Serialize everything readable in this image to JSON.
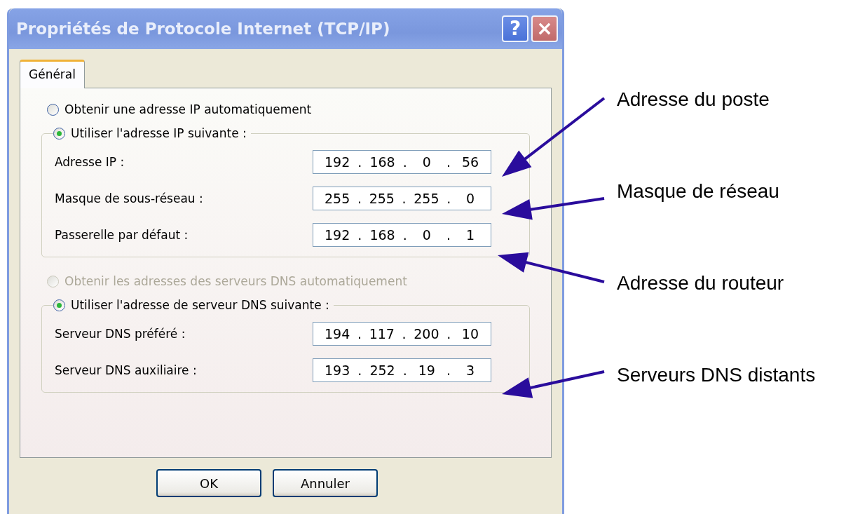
{
  "window": {
    "title": "Propriétés de Protocole Internet (TCP/IP)",
    "help": "?",
    "close": "×"
  },
  "tabs": [
    {
      "label": "Général",
      "selected": true
    }
  ],
  "ip_auto": {
    "label": "Obtenir une adresse IP automatiquement",
    "selected": false,
    "disabled": false
  },
  "ip_group": {
    "radio": {
      "label": "Utiliser l'adresse IP suivante :",
      "selected": true,
      "disabled": false
    },
    "fields": [
      {
        "label": "Adresse IP :",
        "octets": [
          "192",
          "168",
          "0",
          "56"
        ]
      },
      {
        "label": "Masque de sous-réseau :",
        "octets": [
          "255",
          "255",
          "255",
          "0"
        ]
      },
      {
        "label": "Passerelle par défaut :",
        "octets": [
          "192",
          "168",
          "0",
          "1"
        ]
      }
    ]
  },
  "dns_auto": {
    "label": "Obtenir les adresses des serveurs DNS automatiquement",
    "selected": false,
    "disabled": true
  },
  "dns_group": {
    "radio": {
      "label": "Utiliser l'adresse de serveur DNS suivante :",
      "selected": true,
      "disabled": false
    },
    "fields": [
      {
        "label": "Serveur DNS préféré :",
        "octets": [
          "194",
          "117",
          "200",
          "10"
        ]
      },
      {
        "label": "Serveur DNS auxiliaire :",
        "octets": [
          "193",
          "252",
          "19",
          "3"
        ]
      }
    ]
  },
  "separator": ".",
  "buttons": [
    "OK",
    "Annuler"
  ],
  "annotations": [
    {
      "label": "Adresse du poste"
    },
    {
      "label": "Masque de réseau"
    },
    {
      "label": "Adresse du routeur"
    },
    {
      "label": "Serveurs DNS distants"
    }
  ]
}
